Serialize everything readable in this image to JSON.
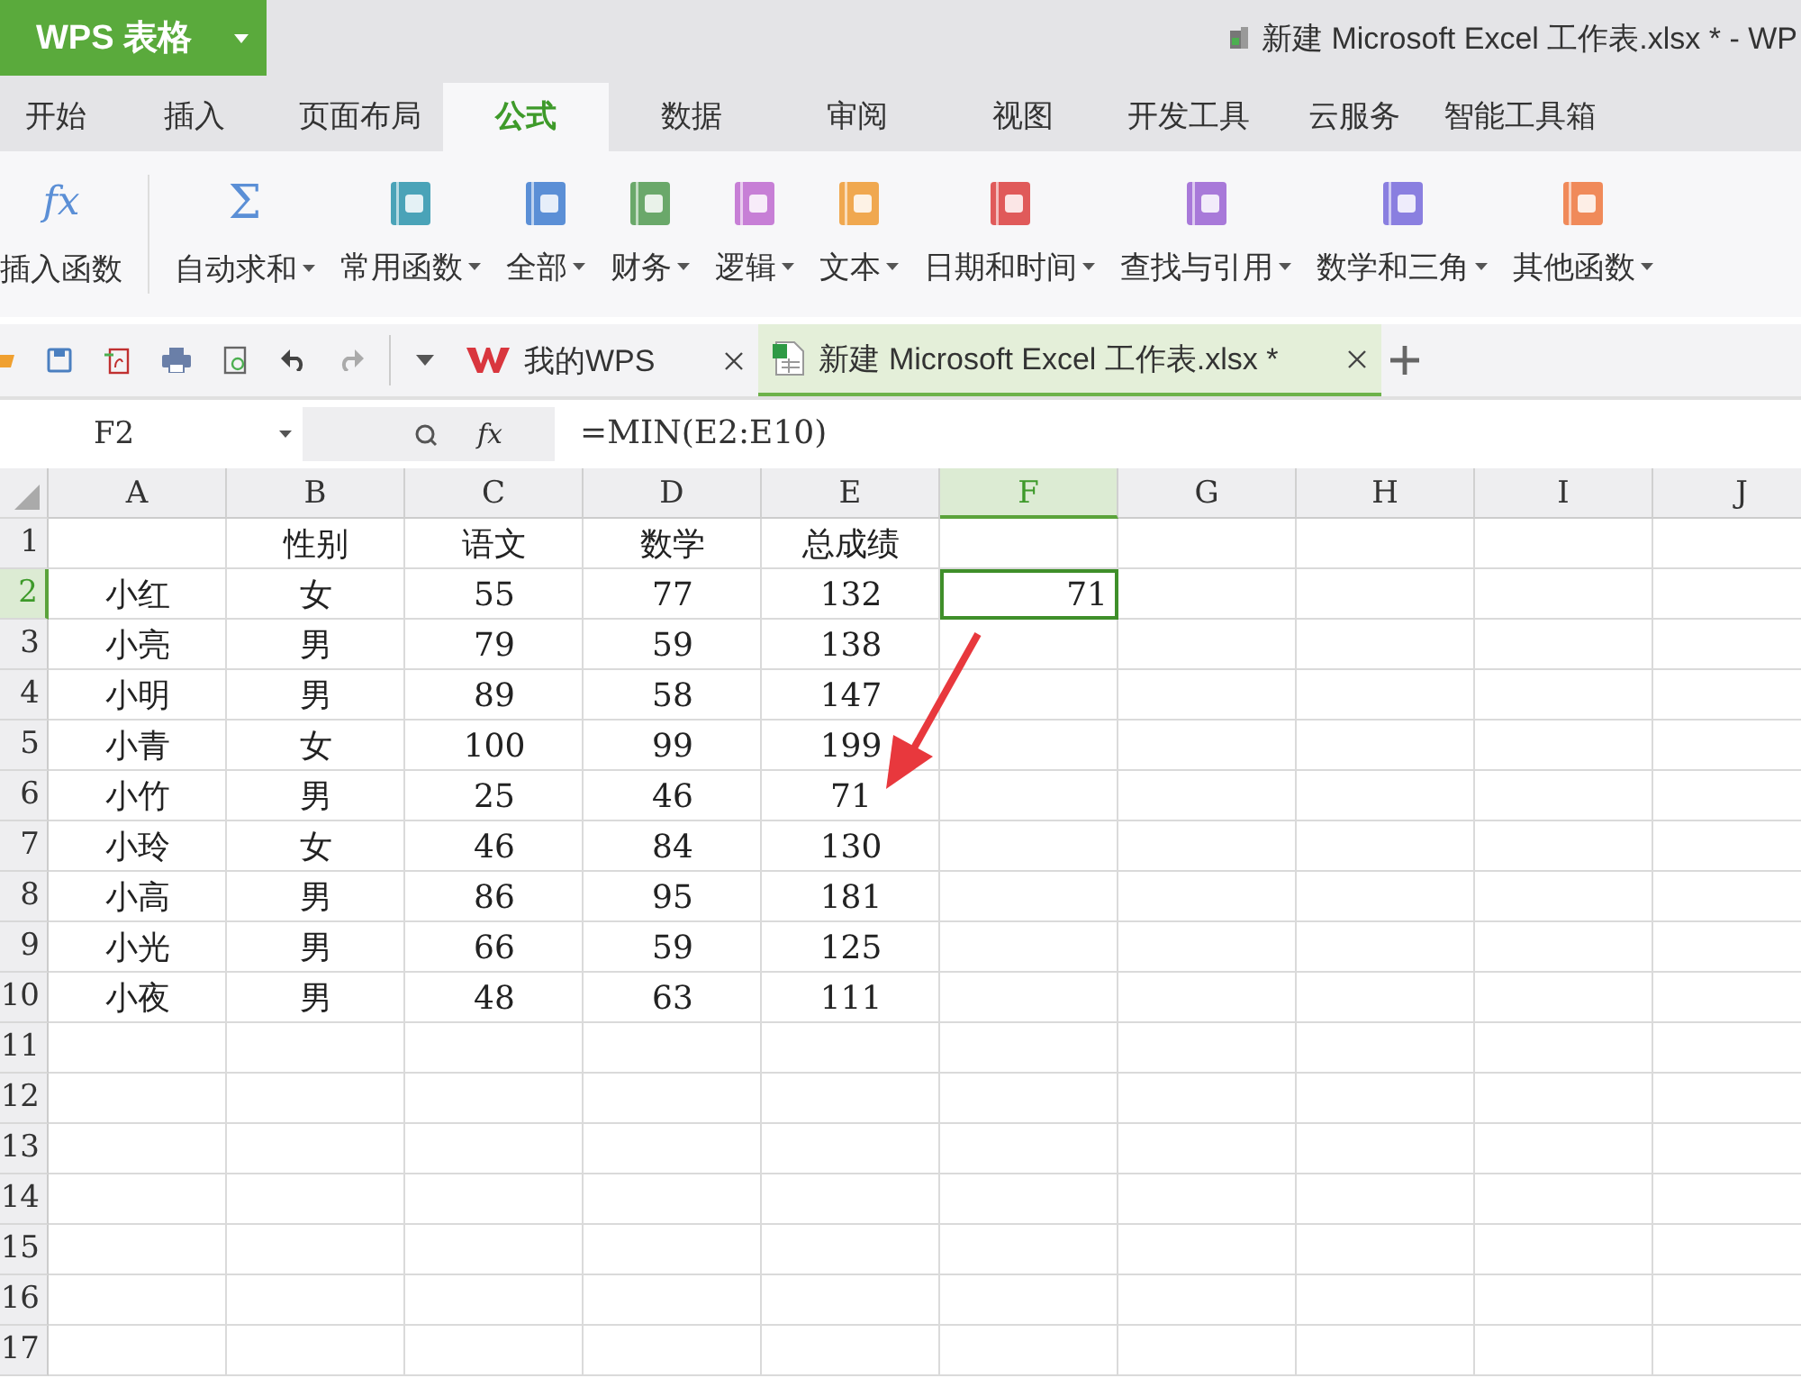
{
  "app": {
    "name": "WPS 表格",
    "title": "新建 Microsoft Excel 工作表.xlsx * - WP"
  },
  "menu_tabs": [
    {
      "label": "开始",
      "selected": false
    },
    {
      "label": "插入",
      "selected": false
    },
    {
      "label": "页面布局",
      "selected": false
    },
    {
      "label": "公式",
      "selected": true
    },
    {
      "label": "数据",
      "selected": false
    },
    {
      "label": "审阅",
      "selected": false
    },
    {
      "label": "视图",
      "selected": false
    },
    {
      "label": "开发工具",
      "selected": false
    },
    {
      "label": "云服务",
      "selected": false
    },
    {
      "label": "智能工具箱",
      "selected": false
    }
  ],
  "ribbon": [
    {
      "label": "插入函数",
      "kind": "glyph",
      "glyph": "fx",
      "dropdown": false
    },
    {
      "label": "自动求和",
      "kind": "glyph",
      "glyph": "Σ",
      "dropdown": true
    },
    {
      "label": "常用函数",
      "kind": "book",
      "color": "#4aa3b8",
      "dropdown": true
    },
    {
      "label": "全部",
      "kind": "book",
      "color": "#5b8fd6",
      "dropdown": true
    },
    {
      "label": "财务",
      "kind": "book",
      "color": "#6aa86a",
      "dropdown": true
    },
    {
      "label": "逻辑",
      "kind": "book",
      "color": "#c77fd6",
      "dropdown": true
    },
    {
      "label": "文本",
      "kind": "book",
      "color": "#f0a850",
      "dropdown": true
    },
    {
      "label": "日期和时间",
      "kind": "book",
      "color": "#e05a5a",
      "dropdown": true
    },
    {
      "label": "查找与引用",
      "kind": "book",
      "color": "#a879d9",
      "dropdown": true
    },
    {
      "label": "数学和三角",
      "kind": "book",
      "color": "#8a7fe0",
      "dropdown": true
    },
    {
      "label": "其他函数",
      "kind": "book",
      "color": "#f08a5a",
      "dropdown": true
    }
  ],
  "doc_tabs": [
    {
      "label": "我的WPS",
      "selected": false
    },
    {
      "label": "新建 Microsoft Excel 工作表.xlsx *",
      "selected": true
    }
  ],
  "formula_bar": {
    "name_box": "F2",
    "function_button": "fx",
    "formula": "=MIN(E2:E10)"
  },
  "grid": {
    "columns": [
      {
        "label": "A",
        "selected": false
      },
      {
        "label": "B",
        "selected": false
      },
      {
        "label": "C",
        "selected": false
      },
      {
        "label": "D",
        "selected": false
      },
      {
        "label": "E",
        "selected": false
      },
      {
        "label": "F",
        "selected": true
      },
      {
        "label": "G",
        "selected": false
      },
      {
        "label": "H",
        "selected": false
      },
      {
        "label": "I",
        "selected": false
      },
      {
        "label": "J",
        "selected": false
      }
    ],
    "rows": [
      {
        "number": "1",
        "selected": false,
        "cells": [
          null,
          "性别",
          "语文",
          "数学",
          "总成绩"
        ]
      },
      {
        "number": "2",
        "selected": true,
        "cells": [
          "小红",
          "女",
          "55",
          "77",
          "132",
          "71"
        ]
      },
      {
        "number": "3",
        "selected": false,
        "cells": [
          "小亮",
          "男",
          "79",
          "59",
          "138"
        ]
      },
      {
        "number": "4",
        "selected": false,
        "cells": [
          "小明",
          "男",
          "89",
          "58",
          "147"
        ]
      },
      {
        "number": "5",
        "selected": false,
        "cells": [
          "小青",
          "女",
          "100",
          "99",
          "199"
        ]
      },
      {
        "number": "6",
        "selected": false,
        "cells": [
          "小竹",
          "男",
          "25",
          "46",
          "71"
        ]
      },
      {
        "number": "7",
        "selected": false,
        "cells": [
          "小玲",
          "女",
          "46",
          "84",
          "130"
        ]
      },
      {
        "number": "8",
        "selected": false,
        "cells": [
          "小高",
          "男",
          "86",
          "95",
          "181"
        ]
      },
      {
        "number": "9",
        "selected": false,
        "cells": [
          "小光",
          "男",
          "66",
          "59",
          "125"
        ]
      },
      {
        "number": "10",
        "selected": false,
        "cells": [
          "小夜",
          "男",
          "48",
          "63",
          "111"
        ]
      },
      {
        "number": "11",
        "selected": false,
        "cells": []
      },
      {
        "number": "12",
        "selected": false,
        "cells": []
      },
      {
        "number": "13",
        "selected": false,
        "cells": []
      },
      {
        "number": "14",
        "selected": false,
        "cells": []
      },
      {
        "number": "15",
        "selected": false,
        "cells": []
      },
      {
        "number": "16",
        "selected": false,
        "cells": []
      },
      {
        "number": "17",
        "selected": false,
        "cells": []
      }
    ]
  }
}
